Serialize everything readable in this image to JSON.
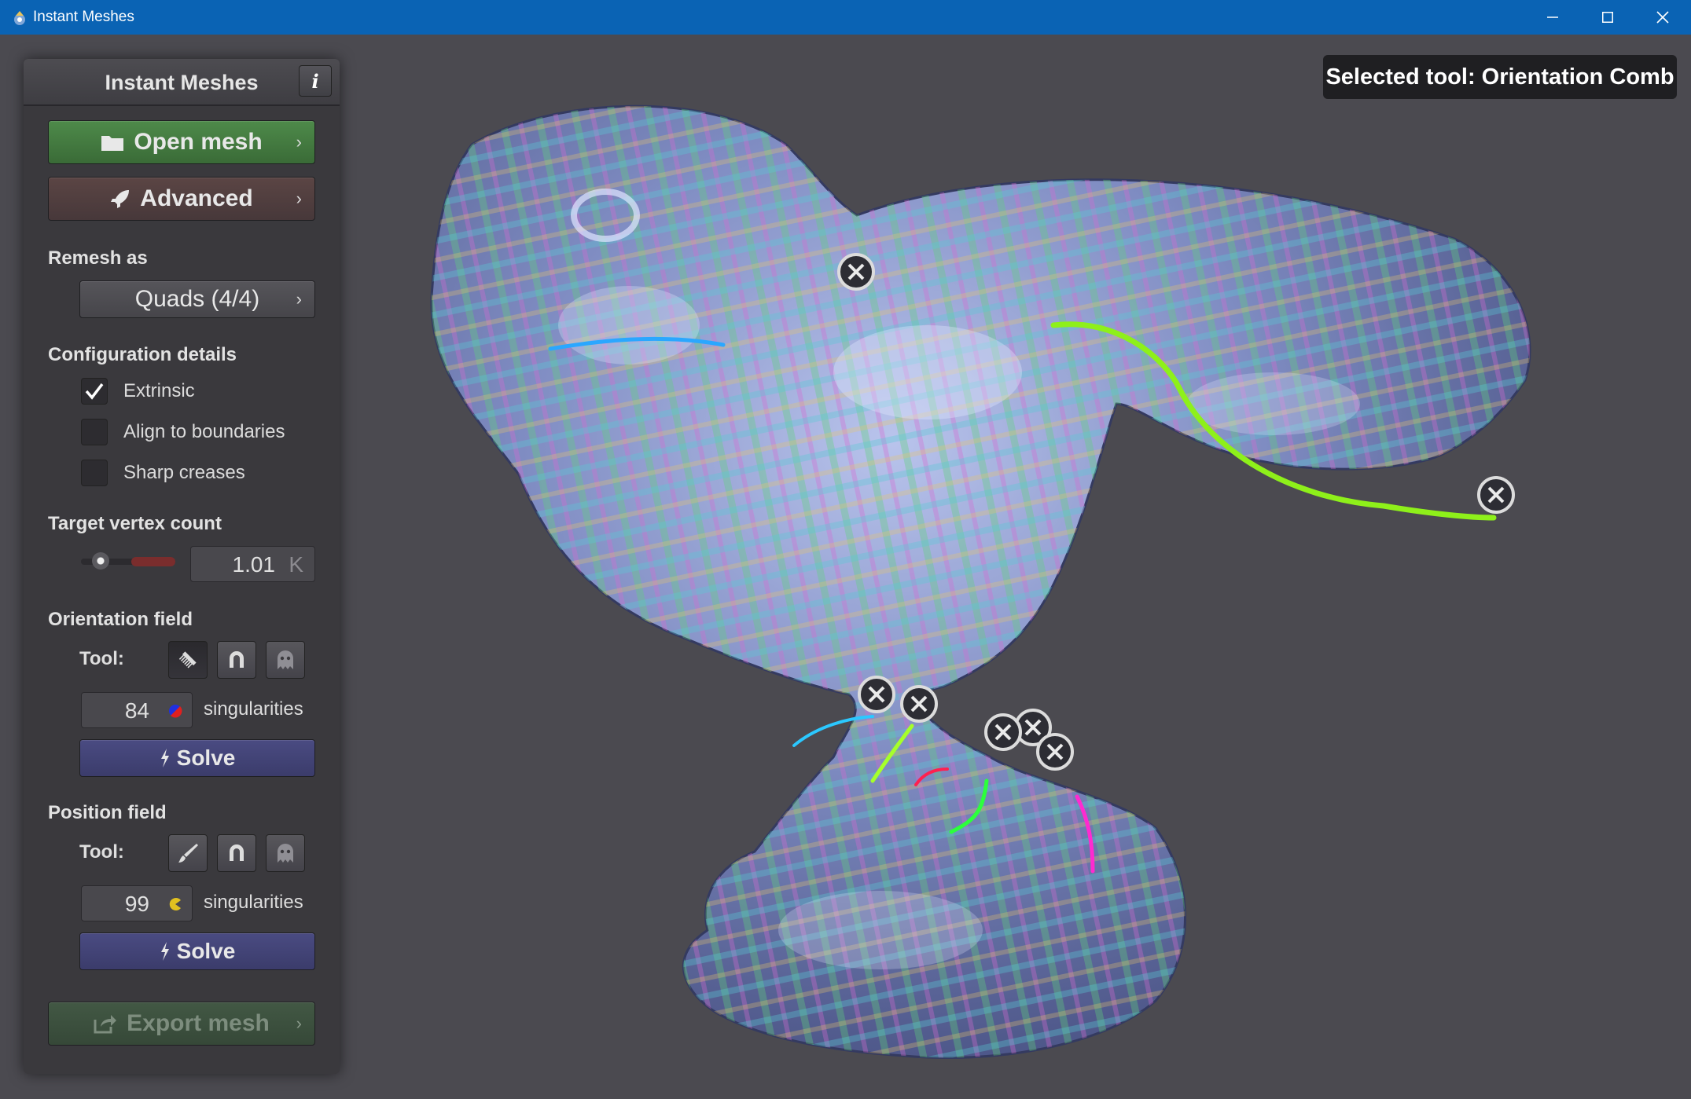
{
  "window": {
    "title": "Instant Meshes",
    "controls": [
      "minimize-icon",
      "maximize-icon",
      "close-icon"
    ]
  },
  "panel": {
    "title": "Instant Meshes",
    "info_label": "i",
    "open_mesh": "Open mesh",
    "advanced": "Advanced",
    "remesh_as_label": "Remesh as",
    "remesh_mode": "Quads (4/4)",
    "config_label": "Configuration details",
    "options": [
      {
        "label": "Extrinsic",
        "checked": true
      },
      {
        "label": "Align to boundaries",
        "checked": false
      },
      {
        "label": "Sharp creases",
        "checked": false
      }
    ],
    "target_label": "Target vertex count",
    "target_value": "1.01",
    "target_unit": "K",
    "orientation": {
      "section": "Orientation field",
      "tool_label": "Tool:",
      "singularities_count": "84",
      "singularities_label": "singularities",
      "solve": "Solve",
      "tools": [
        "comb-icon",
        "magnet-icon",
        "ghost-icon"
      ]
    },
    "position": {
      "section": "Position field",
      "tool_label": "Tool:",
      "singularities_count": "99",
      "singularities_label": "singularities",
      "solve": "Solve",
      "tools": [
        "brush-icon",
        "magnet-icon",
        "ghost-icon"
      ]
    },
    "export": "Export mesh"
  },
  "viewport": {
    "selected_tool": "Selected tool: Orientation Comb"
  },
  "colors": {
    "titlebar": "#0a63b4",
    "background": "#4b4a50",
    "panel": "#3a393d",
    "mesh": "#7f8fc4",
    "stroke_green": "#8ef01a"
  }
}
